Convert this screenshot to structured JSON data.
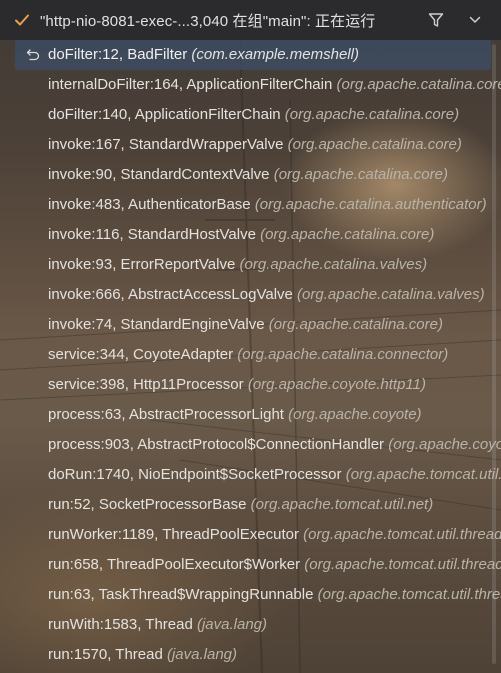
{
  "header": {
    "title": "\"http-nio-8081-exec-...3,040 在组\"main\": 正在运行",
    "icons": {
      "status": "check-icon",
      "filter": "filter-icon",
      "dropdown": "chevron-down-icon"
    },
    "colors": {
      "check": "#e8a04a"
    }
  },
  "frames": [
    {
      "method": "doFilter:12, BadFilter",
      "pkg": "(com.example.memshell)",
      "selected": true
    },
    {
      "method": "internalDoFilter:164, ApplicationFilterChain",
      "pkg": "(org.apache.catalina.core)"
    },
    {
      "method": "doFilter:140, ApplicationFilterChain",
      "pkg": "(org.apache.catalina.core)"
    },
    {
      "method": "invoke:167, StandardWrapperValve",
      "pkg": "(org.apache.catalina.core)"
    },
    {
      "method": "invoke:90, StandardContextValve",
      "pkg": "(org.apache.catalina.core)"
    },
    {
      "method": "invoke:483, AuthenticatorBase",
      "pkg": "(org.apache.catalina.authenticator)"
    },
    {
      "method": "invoke:116, StandardHostValve",
      "pkg": "(org.apache.catalina.core)"
    },
    {
      "method": "invoke:93, ErrorReportValve",
      "pkg": "(org.apache.catalina.valves)"
    },
    {
      "method": "invoke:666, AbstractAccessLogValve",
      "pkg": "(org.apache.catalina.valves)"
    },
    {
      "method": "invoke:74, StandardEngineValve",
      "pkg": "(org.apache.catalina.core)"
    },
    {
      "method": "service:344, CoyoteAdapter",
      "pkg": "(org.apache.catalina.connector)"
    },
    {
      "method": "service:398, Http11Processor",
      "pkg": "(org.apache.coyote.http11)"
    },
    {
      "method": "process:63, AbstractProcessorLight",
      "pkg": "(org.apache.coyote)"
    },
    {
      "method": "process:903, AbstractProtocol$ConnectionHandler",
      "pkg": "(org.apache.coyote)"
    },
    {
      "method": "doRun:1740, NioEndpoint$SocketProcessor",
      "pkg": "(org.apache.tomcat.util.net)"
    },
    {
      "method": "run:52, SocketProcessorBase",
      "pkg": "(org.apache.tomcat.util.net)"
    },
    {
      "method": "runWorker:1189, ThreadPoolExecutor",
      "pkg": "(org.apache.tomcat.util.threads)"
    },
    {
      "method": "run:658, ThreadPoolExecutor$Worker",
      "pkg": "(org.apache.tomcat.util.threads)"
    },
    {
      "method": "run:63, TaskThread$WrappingRunnable",
      "pkg": "(org.apache.tomcat.util.threads)"
    },
    {
      "method": "runWith:1583, Thread",
      "pkg": "(java.lang)"
    },
    {
      "method": "run:1570, Thread",
      "pkg": "(java.lang)"
    }
  ]
}
